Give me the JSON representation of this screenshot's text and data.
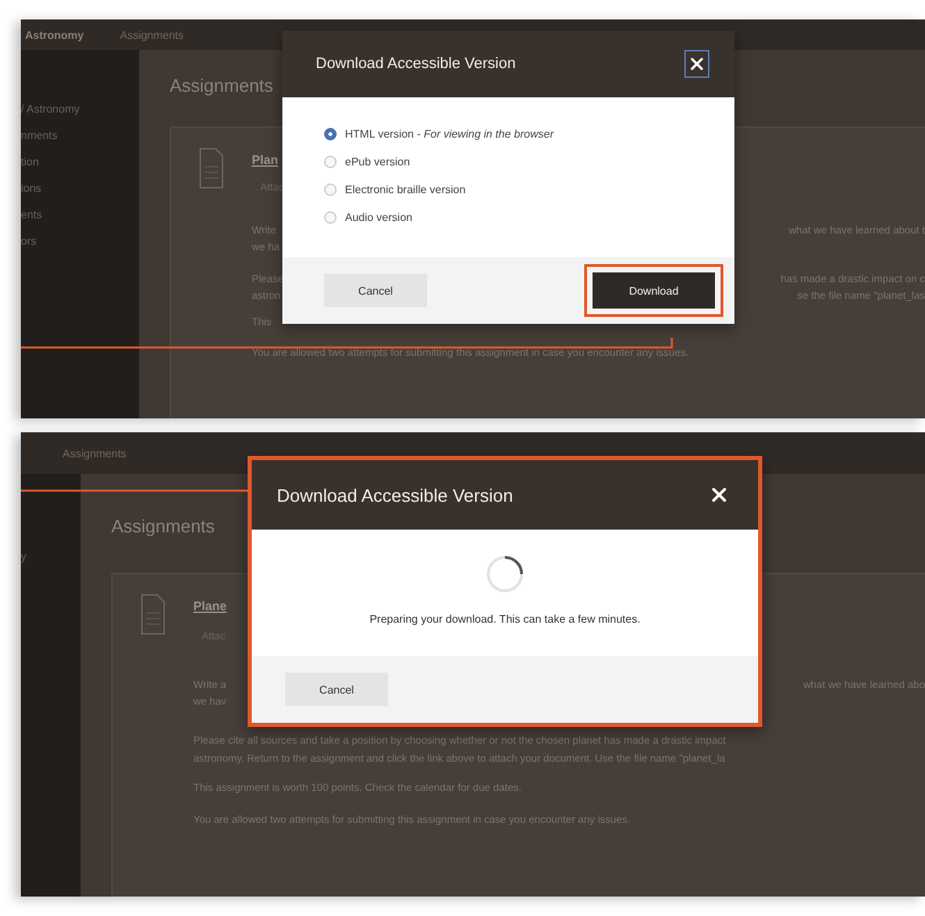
{
  "panels": [
    {
      "kind": "options",
      "top_bar": [
        "Astronomy",
        "Assignments"
      ],
      "sidebar": [
        "/ Astronomy",
        "nments",
        "tion",
        "ions",
        "ents",
        "ors"
      ],
      "heading": "Assignments",
      "item": {
        "title": "Plan",
        "subtitle": "Attac"
      },
      "rows": [
        {
          "left": "Write",
          "right": "what we have learned about t"
        },
        {
          "left": "we ha"
        },
        {
          "left": "Please",
          "right": "has made a drastic impact on c"
        },
        {
          "left": "astron",
          "right": "se the file name \"planet_las"
        },
        {
          "left": "This"
        },
        {
          "left": "You are allowed two attempts for submitting this assignment in case you encounter any issues."
        }
      ],
      "dialog": {
        "title": "Download Accessible Version",
        "highlighted": false,
        "close_focused": true,
        "options": [
          {
            "label": "HTML version - *For viewing in the browser*",
            "selected": true
          },
          {
            "label": "ePub version",
            "selected": false
          },
          {
            "label": "Electronic braille version",
            "selected": false
          },
          {
            "label": "Audio version",
            "selected": false
          }
        ],
        "buttons": [
          {
            "label": "Cancel",
            "kind": "secondary",
            "highlighted": false
          },
          {
            "label": "Download",
            "kind": "primary",
            "highlighted": true
          }
        ]
      }
    },
    {
      "kind": "progress",
      "top_bar": [
        "Assignments"
      ],
      "sidebar": [
        "y"
      ],
      "heading": "Assignments",
      "item": {
        "title": "Plane",
        "subtitle": "Attac"
      },
      "rows": [
        {
          "left": "Write a",
          "right": "what we have learned abo"
        },
        {
          "left": "we hav"
        },
        {
          "left": "Please cite all sources and take a position by choosing whether or not the chosen planet has made a drastic impact"
        },
        {
          "left": "astronomy. Return to the assignment and click the link above to attach your document. Use the file name \"planet_la"
        },
        {
          "left": "This assignment is worth 100 points. Check the calendar for due dates."
        },
        {
          "left": "You are allowed two attempts for submitting this assignment in case you encounter any issues."
        }
      ],
      "dialog": {
        "title": "Download Accessible Version",
        "highlighted": true,
        "close_focused": false,
        "message": "Preparing your download. This can take a few minutes.",
        "buttons": [
          {
            "label": "Cancel",
            "kind": "secondary",
            "highlighted": false
          }
        ]
      }
    }
  ]
}
